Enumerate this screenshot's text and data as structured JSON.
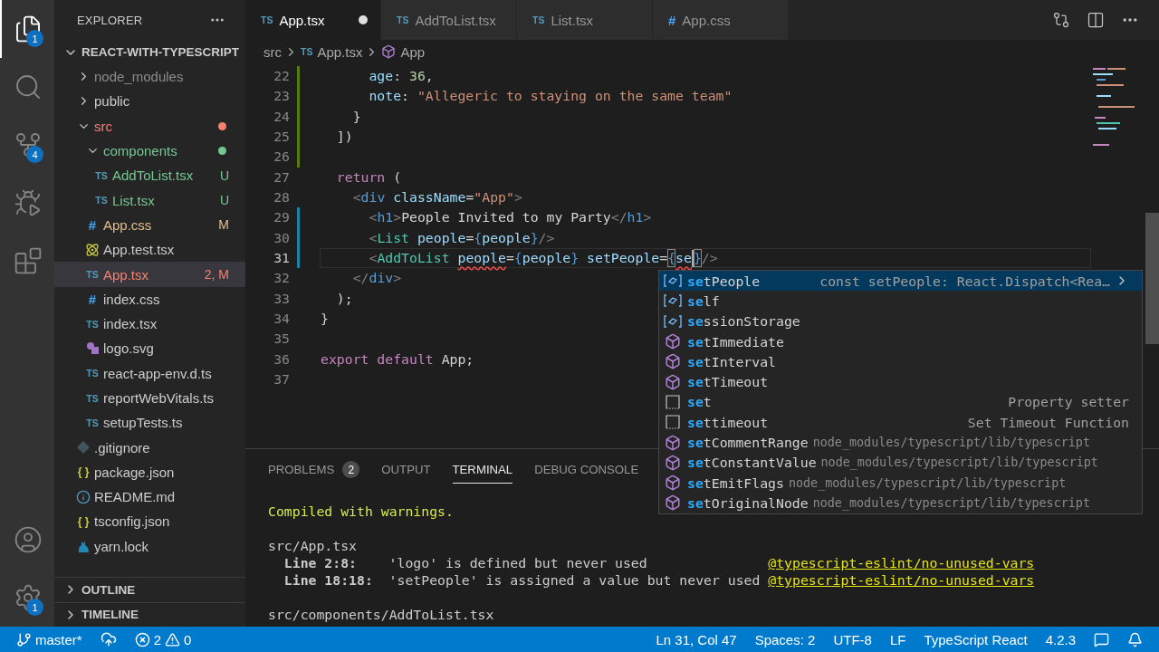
{
  "activity_bar": {
    "items": [
      {
        "kind": "explorer",
        "selected": true,
        "badge": "1"
      },
      {
        "kind": "search",
        "selected": false
      },
      {
        "kind": "source-control",
        "selected": false,
        "badge": "4"
      },
      {
        "kind": "run",
        "selected": false
      },
      {
        "kind": "extensions",
        "selected": false
      }
    ],
    "bottom_items": [
      {
        "kind": "account"
      },
      {
        "kind": "settings",
        "badge": "1"
      }
    ]
  },
  "sidebar": {
    "title": "EXPLORER",
    "project": {
      "name": "REACT-WITH-TYPESCRIPT",
      "expanded": true
    },
    "tree": [
      {
        "name": "node_modules",
        "kind": "folder",
        "expanded": false,
        "color": "#8c8c8c",
        "selected": false
      },
      {
        "name": "public",
        "kind": "folder",
        "expanded": false,
        "color": "#cccccc",
        "selected": false
      },
      {
        "name": "src",
        "kind": "folder",
        "expanded": true,
        "dot": true,
        "color": "#f88070",
        "selected": false,
        "children": [
          {
            "name": "components",
            "kind": "folder",
            "expanded": true,
            "dot": true,
            "color": "#73c991",
            "selected": false,
            "children": [
              {
                "name": "AddToList.tsx",
                "kind": "ts",
                "glyph": "TS",
                "color": "#73c991",
                "badge": "U",
                "selected": false
              },
              {
                "name": "List.tsx",
                "kind": "ts",
                "glyph": "TS",
                "color": "#73c991",
                "badge": "U",
                "selected": false
              }
            ]
          },
          {
            "name": "App.css",
            "kind": "css",
            "glyph": "#",
            "color": "#e2c08d",
            "badge": "M",
            "selected": false
          },
          {
            "name": "App.test.tsx",
            "kind": "react",
            "color": "#cccccc",
            "selected": false
          },
          {
            "name": "App.tsx",
            "kind": "ts",
            "glyph": "TS",
            "color": "#f88070",
            "badge": "2, M",
            "selected": true
          },
          {
            "name": "index.css",
            "kind": "css",
            "glyph": "#",
            "color": "#cccccc",
            "selected": false
          },
          {
            "name": "index.tsx",
            "kind": "ts",
            "glyph": "TS",
            "color": "#cccccc",
            "selected": false
          },
          {
            "name": "logo.svg",
            "kind": "svg",
            "color": "#cccccc",
            "selected": false
          },
          {
            "name": "react-app-env.d.ts",
            "kind": "ts",
            "glyph": "TS",
            "color": "#cccccc",
            "selected": false
          },
          {
            "name": "reportWebVitals.ts",
            "kind": "ts",
            "glyph": "TS",
            "color": "#cccccc",
            "selected": false
          },
          {
            "name": "setupTests.ts",
            "kind": "ts",
            "glyph": "TS",
            "color": "#cccccc",
            "selected": false
          }
        ]
      },
      {
        "name": ".gitignore",
        "kind": "git",
        "color": "#cccccc",
        "selected": false
      },
      {
        "name": "package.json",
        "kind": "json",
        "glyph": "{ }",
        "color": "#cccccc",
        "selected": false
      },
      {
        "name": "README.md",
        "kind": "info",
        "color": "#cccccc",
        "selected": false
      },
      {
        "name": "tsconfig.json",
        "kind": "json",
        "glyph": "{ }",
        "color": "#cccccc",
        "selected": false
      },
      {
        "name": "yarn.lock",
        "kind": "yarn",
        "color": "#cccccc",
        "selected": false
      }
    ],
    "sections": [
      {
        "title": "OUTLINE",
        "expanded": false
      },
      {
        "title": "TIMELINE",
        "expanded": false
      }
    ]
  },
  "tabs": [
    {
      "label": "App.tsx",
      "kind": "ts",
      "glyph": "TS",
      "selected": true,
      "dirty": true
    },
    {
      "label": "AddToList.tsx",
      "kind": "ts",
      "glyph": "TS",
      "selected": false,
      "dirty": false
    },
    {
      "label": "List.tsx",
      "kind": "ts",
      "glyph": "TS",
      "selected": false,
      "dirty": false
    },
    {
      "label": "App.css",
      "kind": "css",
      "glyph": "#",
      "selected": false,
      "dirty": false
    }
  ],
  "breadcrumbs": [
    {
      "label": "src"
    },
    {
      "label": "App.tsx",
      "kind": "ts",
      "glyph": "TS"
    },
    {
      "label": "App",
      "kind": "component"
    }
  ],
  "editor": {
    "lines": [
      {
        "number": "22",
        "color": "#587c0c",
        "current": false,
        "tokens": [
          {
            "kind": "prop",
            "text": "      age"
          },
          {
            "kind": "op",
            "text": ": "
          },
          {
            "kind": "number",
            "text": "36"
          },
          {
            "kind": "op",
            "text": ","
          }
        ]
      },
      {
        "number": "23",
        "color": "#587c0c",
        "current": false,
        "tokens": [
          {
            "kind": "prop",
            "text": "      note"
          },
          {
            "kind": "op",
            "text": ": "
          },
          {
            "kind": "string",
            "text": "\"Allegeric to staying on the same team\""
          }
        ]
      },
      {
        "number": "24",
        "color": "#587c0c",
        "current": false,
        "tokens": [
          {
            "kind": "op",
            "text": "    }"
          }
        ]
      },
      {
        "number": "25",
        "color": "#587c0c",
        "current": false,
        "tokens": [
          {
            "kind": "op",
            "text": "  ])"
          }
        ]
      },
      {
        "number": "26",
        "color": "#587c0c",
        "current": false
      },
      {
        "number": "27",
        "current": false,
        "tokens": [
          {
            "kind": "keyword",
            "text": "  return"
          },
          {
            "kind": "op",
            "text": " ("
          }
        ]
      },
      {
        "number": "28",
        "current": false,
        "tokens": [
          {
            "kind": "tag",
            "text": "    <"
          },
          {
            "kind": "html",
            "text": "div"
          },
          {
            "kind": "attr",
            "text": " className"
          },
          {
            "kind": "op",
            "text": "="
          },
          {
            "kind": "string",
            "text": "\"App\""
          },
          {
            "kind": "tag",
            "text": ">"
          }
        ]
      },
      {
        "number": "29",
        "color": "#1b81a8",
        "current": false,
        "tokens": [
          {
            "kind": "tag",
            "text": "      <"
          },
          {
            "kind": "html",
            "text": "h1"
          },
          {
            "kind": "tag",
            "text": ">"
          },
          {
            "kind": "op",
            "text": "People Invited to my Party"
          },
          {
            "kind": "tag",
            "text": "</"
          },
          {
            "kind": "html",
            "text": "h1"
          },
          {
            "kind": "tag",
            "text": ">"
          }
        ]
      },
      {
        "number": "30",
        "color": "#1b81a8",
        "current": false,
        "tokens": [
          {
            "kind": "tag",
            "text": "      <"
          },
          {
            "kind": "component",
            "text": "List"
          },
          {
            "kind": "attr",
            "text": " people"
          },
          {
            "kind": "op",
            "text": "="
          },
          {
            "kind": "brace",
            "text": "{"
          },
          {
            "kind": "var",
            "text": "people"
          },
          {
            "kind": "brace",
            "text": "}"
          },
          {
            "kind": "tag",
            "text": "/>"
          }
        ]
      },
      {
        "number": "31",
        "color": "#1b81a8",
        "current": true,
        "tokens": [
          {
            "kind": "tag",
            "text": "      <"
          },
          {
            "kind": "component",
            "text": "AddToList "
          },
          {
            "kind": "attr",
            "text": "people",
            "squiggle": true
          },
          {
            "kind": "op",
            "text": "="
          },
          {
            "kind": "brace",
            "text": "{"
          },
          {
            "kind": "var",
            "text": "people"
          },
          {
            "kind": "brace",
            "text": "}"
          },
          {
            "kind": "attr",
            "text": " setPeople"
          },
          {
            "kind": "op",
            "text": "="
          },
          {
            "kind": "brace",
            "text": "{",
            "matched": true
          },
          {
            "kind": "var",
            "text": "se",
            "squiggle": true,
            "cursor": true
          },
          {
            "kind": "brace",
            "text": "}",
            "matched": true
          },
          {
            "kind": "tag",
            "text": "/>"
          }
        ]
      },
      {
        "number": "32",
        "current": false,
        "tokens": [
          {
            "kind": "tag",
            "text": "    </"
          },
          {
            "kind": "html",
            "text": "div"
          },
          {
            "kind": "tag",
            "text": ">"
          }
        ]
      },
      {
        "number": "33",
        "current": false,
        "tokens": [
          {
            "kind": "op",
            "text": "  );"
          }
        ]
      },
      {
        "number": "34",
        "current": false,
        "tokens": [
          {
            "kind": "op",
            "text": "}"
          }
        ]
      },
      {
        "number": "35",
        "current": false
      },
      {
        "number": "36",
        "current": false,
        "tokens": [
          {
            "kind": "keyword",
            "text": "export default"
          },
          {
            "kind": "op",
            "text": " App;"
          }
        ]
      },
      {
        "number": "37",
        "current": false
      }
    ]
  },
  "suggestions": {
    "items": [
      {
        "kind": "variable",
        "match": "se",
        "rest": "tPeople",
        "detail": "const setPeople: React.Dispatch<Rea…",
        "selected": true
      },
      {
        "kind": "variable",
        "match": "se",
        "rest": "lf",
        "selected": false
      },
      {
        "kind": "variable",
        "match": "se",
        "rest": "ssionStorage",
        "selected": false
      },
      {
        "kind": "module",
        "match": "se",
        "rest": "tImmediate",
        "selected": false
      },
      {
        "kind": "module",
        "match": "se",
        "rest": "tInterval",
        "selected": false
      },
      {
        "kind": "module",
        "match": "se",
        "rest": "tTimeout",
        "selected": false
      },
      {
        "kind": "snippet",
        "match": "se",
        "rest": "t",
        "detail": "Property setter",
        "selected": false
      },
      {
        "kind": "snippet",
        "match": "se",
        "rest": "ttimeout",
        "detail": "Set Timeout Function",
        "selected": false
      },
      {
        "kind": "module",
        "match": "se",
        "rest": "tCommentRange",
        "source": "node_modules/typescript/lib/typescript",
        "selected": false
      },
      {
        "kind": "module",
        "match": "se",
        "rest": "tConstantValue",
        "source": "node_modules/typescript/lib/typescript",
        "selected": false
      },
      {
        "kind": "module",
        "match": "se",
        "rest": "tEmitFlags",
        "source": "node_modules/typescript/lib/typescript",
        "selected": false
      },
      {
        "kind": "module",
        "match": "se",
        "rest": "tOriginalNode",
        "source": "node_modules/typescript/lib/typescript",
        "selected": false
      }
    ]
  },
  "panel": {
    "tabs": [
      {
        "label": "PROBLEMS",
        "badge": "2",
        "selected": false
      },
      {
        "label": "OUTPUT",
        "selected": false
      },
      {
        "label": "TERMINAL",
        "selected": true
      },
      {
        "label": "DEBUG CONSOLE",
        "selected": false
      }
    ],
    "terminal": [
      {
        "kind": "status",
        "text": "Compiled with warnings."
      },
      {
        "kind": "file",
        "text": "src/App.tsx"
      },
      {
        "kind": "warning",
        "location": "Line 2:8:",
        "message": "'logo' is defined but never used",
        "rule": "@typescript-eslint/no-unused-vars"
      },
      {
        "kind": "warning",
        "location": "Line 18:18:",
        "message": "'setPeople' is assigned a value but never used",
        "rule": "@typescript-eslint/no-unused-vars"
      },
      {
        "kind": "file",
        "text": "src/components/AddToList.tsx"
      }
    ]
  },
  "status_bar": {
    "branch": "master*",
    "errors": "2",
    "warnings": "0",
    "items": [
      "Ln 31, Col 47",
      "Spaces: 2",
      "UTF-8",
      "LF",
      "TypeScript React",
      "4.2.3"
    ]
  }
}
